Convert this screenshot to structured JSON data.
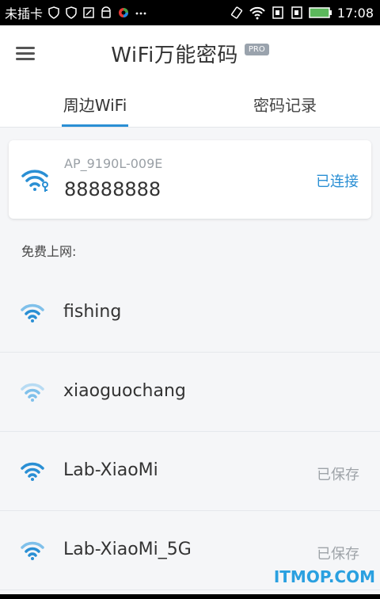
{
  "statusbar": {
    "carrier": "未插卡",
    "time": "17:08",
    "icons_left": [
      "shield-icon",
      "shield-icon",
      "note-icon",
      "android-icon",
      "color-wheel-icon",
      "more-icon"
    ],
    "icons_right": [
      "rotate-icon",
      "wifi-icon",
      "signal-icon",
      "signal-icon",
      "battery-icon"
    ]
  },
  "appbar": {
    "title": "WiFi万能密码",
    "badge": "PRO"
  },
  "tabs": [
    {
      "label": "周边WiFi",
      "active": true
    },
    {
      "label": "密码记录",
      "active": false
    }
  ],
  "connected": {
    "ssid": "AP_9190L-009E",
    "password": "88888888",
    "status": "已连接"
  },
  "section_title": "免费上网:",
  "networks": [
    {
      "name": "fishing",
      "status": ""
    },
    {
      "name": "xiaoguochang",
      "status": ""
    },
    {
      "name": "Lab-XiaoMi",
      "status": "已保存"
    },
    {
      "name": "Lab-XiaoMi_5G",
      "status": "已保存"
    }
  ],
  "watermark": "ITMOP.COM",
  "colors": {
    "accent": "#2a8fd4",
    "wifi_strong": "#2a8fd4",
    "wifi_light": "#7fc0ea"
  }
}
